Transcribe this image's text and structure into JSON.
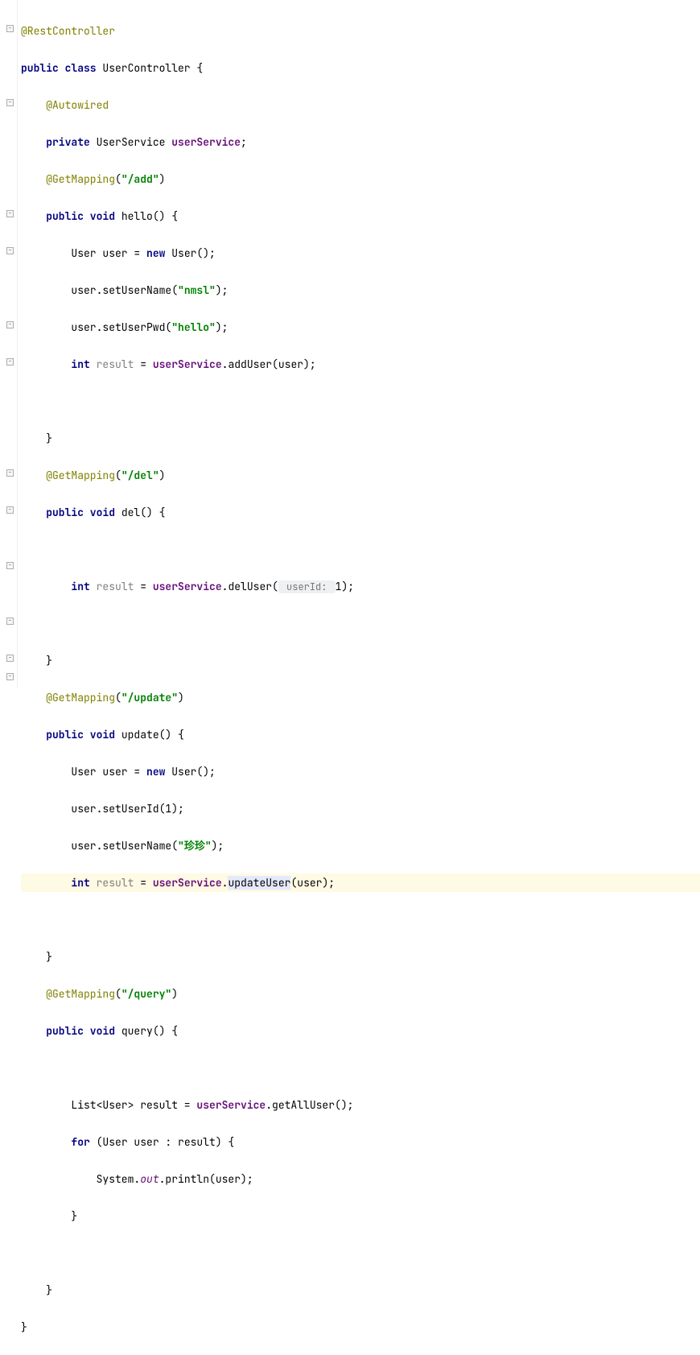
{
  "code": {
    "l0_anno": "@RestController",
    "l1_kw1": "public class",
    "l1_name": " UserController {",
    "l2_anno": "@Autowired",
    "l3_kw": "private",
    "l3_type": " UserService ",
    "l3_field": "userService",
    "l3_semi": ";",
    "l4_anno": "@GetMapping",
    "l4_p1": "(",
    "l4_str": "\"/add\"",
    "l4_p2": ")",
    "l5_kw": "public void",
    "l5_name": " hello() {",
    "l6_a": "User user = ",
    "l6_kw": "new",
    "l6_b": " User();",
    "l7_a": "user.setUserName(",
    "l7_str": "\"nmsl\"",
    "l7_b": ");",
    "l8_a": "user.setUserPwd(",
    "l8_str": "\"hello\"",
    "l8_b": ");",
    "l9_kw": "int",
    "l9_un": " result",
    "l9_a": " = ",
    "l9_f": "userService",
    "l9_b": ".addUser(user);",
    "l11_close": "}",
    "l12_anno": "@GetMapping",
    "l12_p1": "(",
    "l12_str": "\"/del\"",
    "l12_p2": ")",
    "l13_kw": "public void",
    "l13_name": " del() {",
    "l15_kw": "int",
    "l15_un": " result",
    "l15_a": " = ",
    "l15_f": "userService",
    "l15_b": ".delUser(",
    "l15_hint": " userId: ",
    "l15_c": "1);",
    "l17_close": "}",
    "l18_anno": "@GetMapping",
    "l18_p1": "(",
    "l18_str": "\"/update\"",
    "l18_p2": ")",
    "l19_kw": "public void",
    "l19_name": " update() {",
    "l20_a": "User user = ",
    "l20_kw": "new",
    "l20_b": " User();",
    "l21_a": "user.setUserId(1);",
    "l22_a": "user.setUserName(",
    "l22_str": "\"珍珍\"",
    "l22_b": ");",
    "l23_kw": "int",
    "l23_un": " result",
    "l23_a": " = ",
    "l23_f": "userService",
    "l23_b": ".",
    "l23_m": "updateUser",
    "l23_c": "(user);",
    "l25_close": "}",
    "l26_anno": "@GetMapping",
    "l26_p1": "(",
    "l26_str": "\"/query\"",
    "l26_p2": ")",
    "l27_kw": "public void",
    "l27_name": " query() {",
    "l29_a": "List<User> result = ",
    "l29_f": "userService",
    "l29_b": ".getAllUser();",
    "l30_kw": "for",
    "l30_a": " (User user : result) {",
    "l31_a": "System.",
    "l31_out": "out",
    "l31_b": ".println(user);",
    "l32_close": "}",
    "l34_close": "}",
    "l35_close": "}"
  },
  "gutter_fold": "−"
}
